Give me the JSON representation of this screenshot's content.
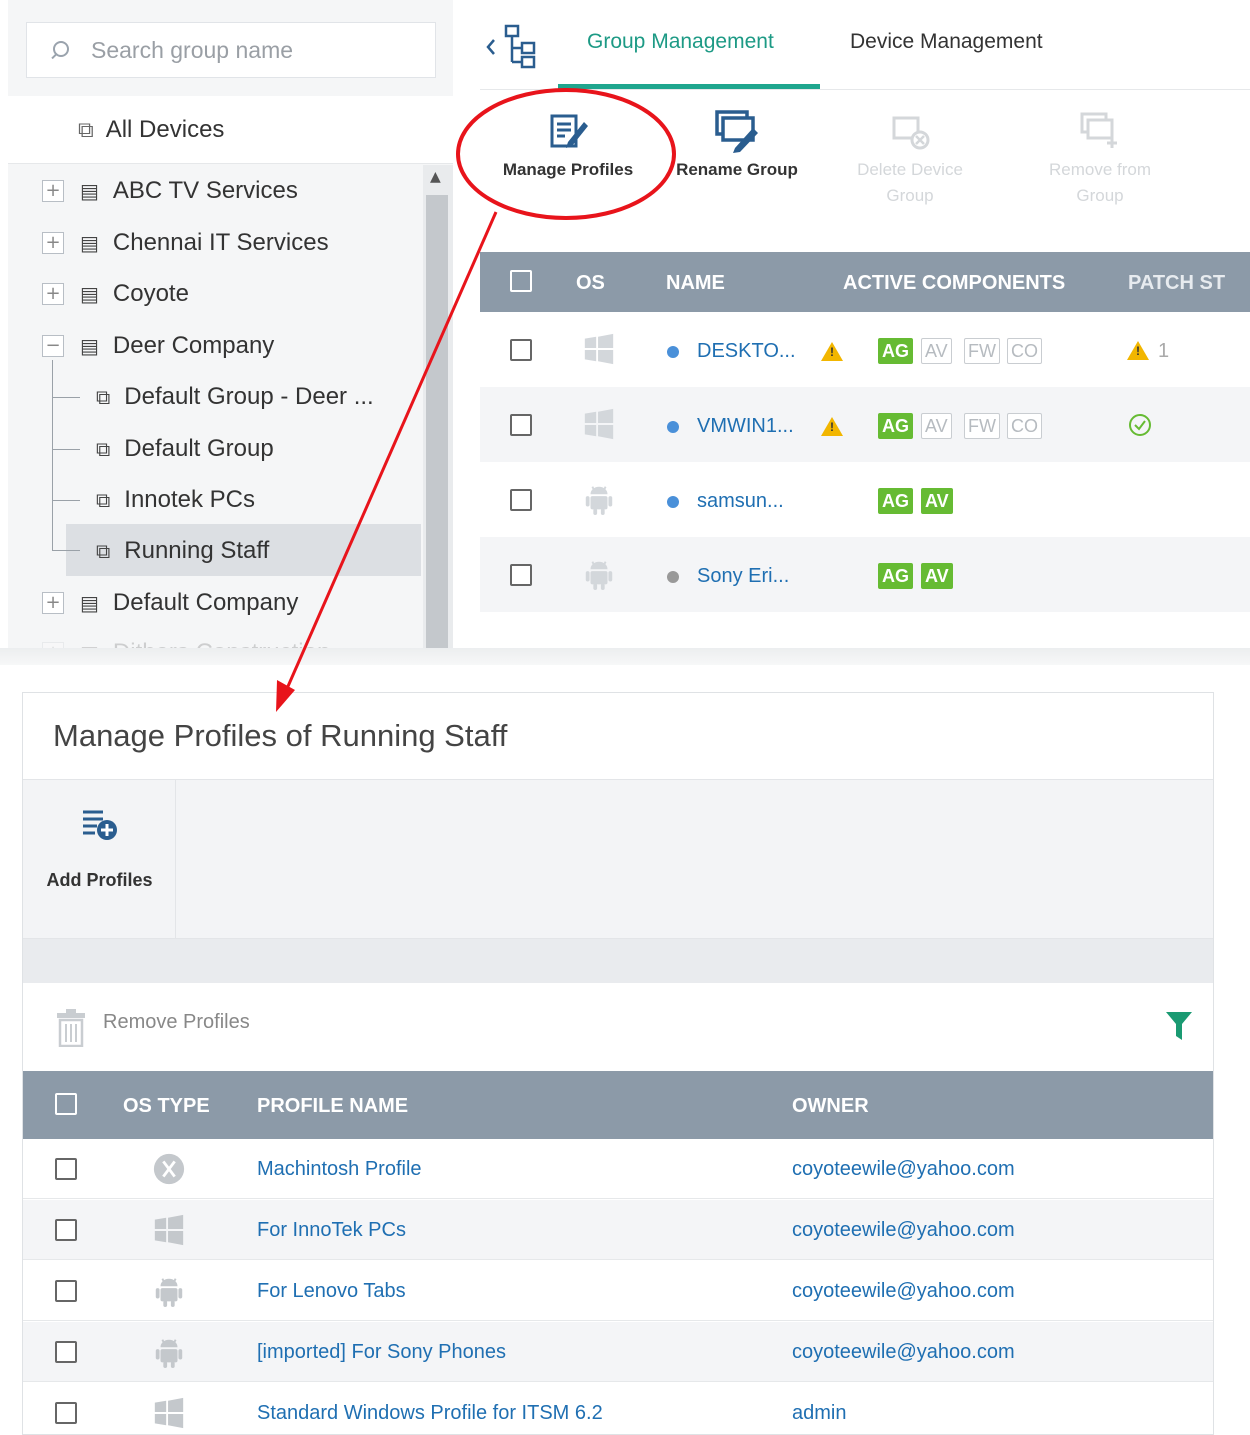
{
  "search": {
    "placeholder": "Search group name"
  },
  "tree": {
    "all_devices": "All Devices",
    "groups": [
      {
        "label": "ABC TV Services",
        "toggle": "+"
      },
      {
        "label": "Chennai IT Services",
        "toggle": "+"
      },
      {
        "label": "Coyote",
        "toggle": "+"
      },
      {
        "label": "Deer Company",
        "toggle": "−"
      },
      {
        "label": "Default Company",
        "toggle": "+"
      },
      {
        "label": "Dithers Construction",
        "toggle": "+"
      }
    ],
    "subgroups": [
      {
        "label": "Default Group - Deer ..."
      },
      {
        "label": "Default Group"
      },
      {
        "label": "Innotek PCs"
      },
      {
        "label": "Running Staff",
        "selected": true
      }
    ]
  },
  "tabs": {
    "group_management": "Group Management",
    "device_management": "Device Management"
  },
  "toolbar": {
    "manage_profiles": "Manage Profiles",
    "rename_group": "Rename Group",
    "delete_device_group_1": "Delete Device",
    "delete_device_group_2": "Group",
    "remove_from_group_1": "Remove from",
    "remove_from_group_2": "Group"
  },
  "device_table": {
    "headers": {
      "os": "OS",
      "name": "NAME",
      "active_components": "ACTIVE COMPONENTS",
      "patch_status": "PATCH ST"
    },
    "rows": [
      {
        "os": "windows",
        "name": "DESKTO...",
        "status_color": "#4a90d9",
        "warning": true,
        "badges": [
          "AG",
          "AV",
          "FW",
          "CO"
        ],
        "active": [
          "AG"
        ],
        "patch": "warning",
        "patch_count": "1"
      },
      {
        "os": "windows",
        "name": "VMWIN1...",
        "status_color": "#4a90d9",
        "warning": true,
        "badges": [
          "AG",
          "AV",
          "FW",
          "CO"
        ],
        "active": [
          "AG"
        ],
        "patch": "ok",
        "patch_count": ""
      },
      {
        "os": "android",
        "name": "samsun...",
        "status_color": "#4a90d9",
        "warning": false,
        "badges": [
          "AG",
          "AV"
        ],
        "active": [
          "AG",
          "AV"
        ],
        "patch": "",
        "patch_count": ""
      },
      {
        "os": "android",
        "name": "Sony Eri...",
        "status_color": "#999999",
        "warning": false,
        "badges": [
          "AG",
          "AV"
        ],
        "active": [
          "AG",
          "AV"
        ],
        "patch": "",
        "patch_count": ""
      }
    ]
  },
  "dialog": {
    "title": "Manage Profiles of Running Staff",
    "add_profiles": "Add Profiles",
    "remove_profiles": "Remove Profiles",
    "headers": {
      "os_type": "OS TYPE",
      "profile_name": "PROFILE NAME",
      "owner": "OWNER"
    },
    "rows": [
      {
        "os": "mac",
        "name": "Machintosh Profile",
        "owner": "coyoteewile@yahoo.com"
      },
      {
        "os": "windows",
        "name": "For InnoTek PCs",
        "owner": "coyoteewile@yahoo.com"
      },
      {
        "os": "android",
        "name": "For Lenovo Tabs",
        "owner": "coyoteewile@yahoo.com"
      },
      {
        "os": "android",
        "name": "[imported] For Sony Phones",
        "owner": "coyoteewile@yahoo.com"
      },
      {
        "os": "windows",
        "name": "Standard Windows Profile for ITSM 6.2",
        "owner": "admin"
      }
    ]
  },
  "colors": {
    "accent": "#1fa68e",
    "header": "#8c9aa8",
    "link": "#1f6fb2",
    "badge_on": "#66bb33",
    "annotation": "#e8141b"
  }
}
